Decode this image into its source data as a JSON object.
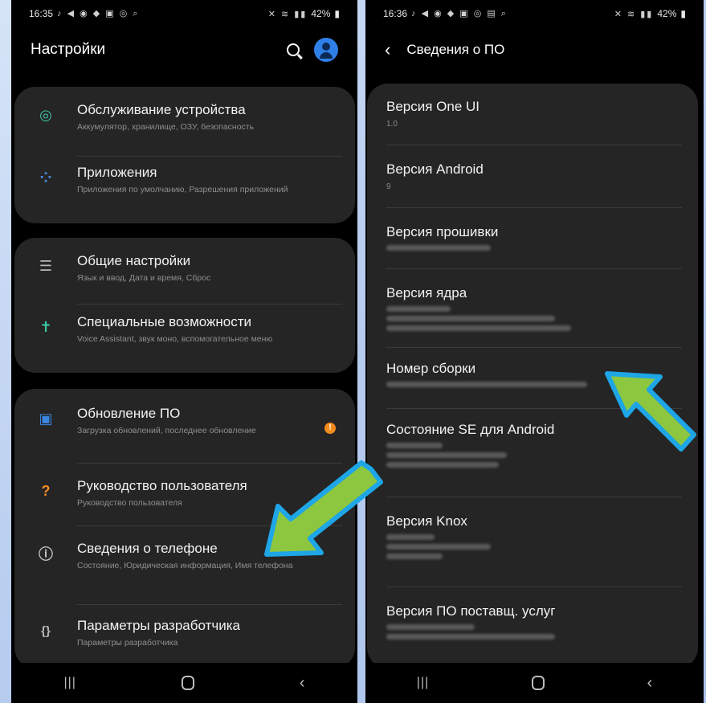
{
  "left": {
    "status": {
      "time": "16:35",
      "battery": "42%"
    },
    "title": "Настройки",
    "rows": [
      {
        "title": "Обслуживание устройства",
        "sub": "Аккумулятор, хранилище, ОЗУ, безопасность",
        "icon": "device-care-icon",
        "glyph": "◎",
        "color": "#3ec7a7"
      },
      {
        "title": "Приложения",
        "sub": "Приложения по умолчанию, Разрешения приложений",
        "icon": "apps-icon",
        "glyph": "⁘",
        "color": "#4a90e8"
      },
      {
        "title": "Общие настройки",
        "sub": "Язык и ввод, Дата и время, Сброс",
        "icon": "sliders-icon",
        "glyph": "☰",
        "color": "#b8b8b8"
      },
      {
        "title": "Специальные возможности",
        "sub": "Voice Assistant, звук моно, вспомогательное меню",
        "icon": "accessibility-icon",
        "glyph": "✝",
        "color": "#3ec7a7"
      },
      {
        "title": "Обновление ПО",
        "sub": "Загрузка обновлений, последнее обновление",
        "icon": "software-update-icon",
        "glyph": "▣",
        "color": "#3a86e0"
      },
      {
        "title": "Руководство пользователя",
        "sub": "Руководство пользователя",
        "icon": "user-manual-icon",
        "glyph": "?",
        "color": "#f08a24"
      },
      {
        "title": "Сведения о телефоне",
        "sub": "Состояние, Юридическая информация, Имя телефона",
        "icon": "info-icon",
        "glyph": "i",
        "color": "#c8c8c8"
      },
      {
        "title": "Параметры разработчика",
        "sub": "Параметры разработчика",
        "icon": "developer-options-icon",
        "glyph": "{}",
        "color": "#b8b8b8"
      }
    ],
    "update_badge": "!"
  },
  "right": {
    "status": {
      "time": "16:36",
      "battery": "42%"
    },
    "title": "Сведения о ПО",
    "rows": [
      {
        "title": "Версия One UI",
        "value": "1.0"
      },
      {
        "title": "Версия Android",
        "value": "9"
      },
      {
        "title": "Версия прошивки",
        "value": ""
      },
      {
        "title": "Версия ядра",
        "value": ""
      },
      {
        "title": "Номер сборки",
        "value": ""
      },
      {
        "title": "Состояние SE для Android",
        "value": ""
      },
      {
        "title": "Версия Knox",
        "value": ""
      },
      {
        "title": "Версия ПО поставщ. услуг",
        "value": ""
      }
    ]
  },
  "colors": {
    "arrow_fill": "#8dc63f",
    "arrow_outline": "#1ea6e6",
    "card": "#252525",
    "background": "#000000"
  }
}
